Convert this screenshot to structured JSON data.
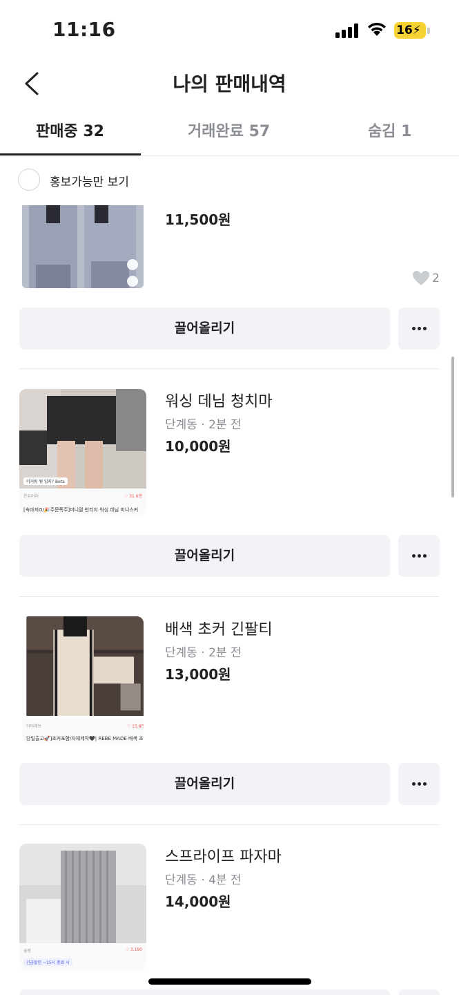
{
  "status_bar": {
    "time": "11:16",
    "battery": "16"
  },
  "header": {
    "title": "나의 판매내역"
  },
  "tabs": [
    {
      "label": "판매중 32",
      "active": true
    },
    {
      "label": "거래완료 57",
      "active": false
    },
    {
      "label": "숨김 1",
      "active": false
    }
  ],
  "filter": {
    "label": "홍보가능만 보기",
    "checked": false
  },
  "items": [
    {
      "title": "",
      "meta": "",
      "price": "11,500원",
      "likes": "2",
      "bump_label": "끌어올리기"
    },
    {
      "title": "워싱 데님 청치마",
      "meta": "단계동 · 2분 전",
      "price": "10,000원",
      "bump_label": "끌어올리기",
      "thumb_caption": "[속바지O/🎉주문폭주]미니멀 빈티지 워싱 데님 미니스커",
      "thumb_shop": "온유어리",
      "thumb_likes": "♡ 31.6만",
      "thumb_tag": "이거랑 뭐 입지? Beta"
    },
    {
      "title": "배색 초커 긴팔티",
      "meta": "단계동 · 2분 전",
      "price": "13,000원",
      "bump_label": "끌어올리기",
      "thumb_caption": "당일출고🚀]초커포함/자체제작🖤| REBE MADE 배색 초",
      "thumb_shop": "아이레브",
      "thumb_likes": "♡ 15.8만"
    },
    {
      "title": "스프라이프 파자마",
      "meta": "단계동 · 4분 전",
      "price": "14,000원",
      "thumb_shop": "꿈랑",
      "thumb_likes": "♡ 3,190",
      "thumb_tag": "긴급할인 ~15시 종료 시"
    }
  ],
  "colors": {
    "accent_battery": "#f7d234",
    "button_bg": "#f2f3f6",
    "text_primary": "#212124",
    "text_secondary": "#8b8e94"
  }
}
